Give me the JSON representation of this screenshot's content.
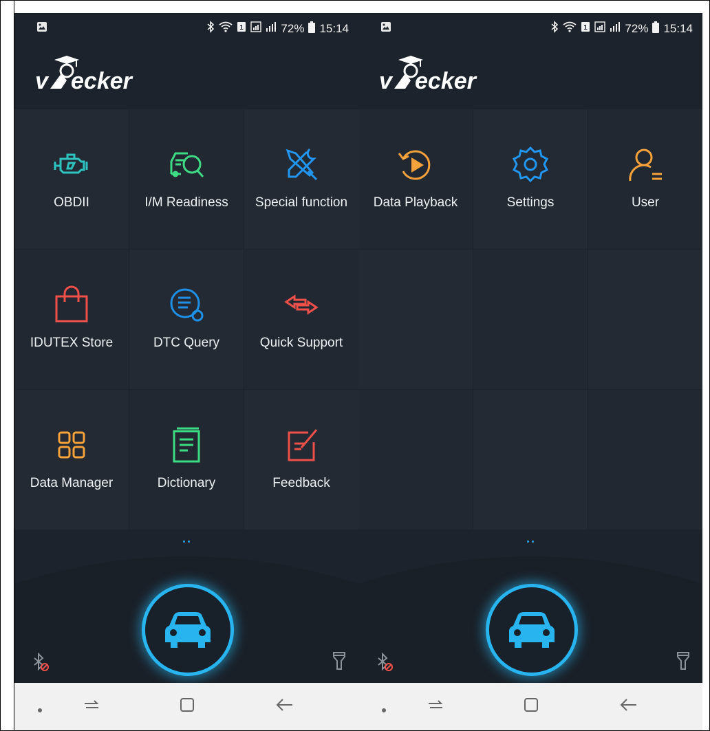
{
  "status_bar": {
    "battery": "72%",
    "time": "15:14",
    "icons": [
      "image-icon",
      "bluetooth-icon",
      "wifi-icon",
      "sim-icon",
      "signal-icon",
      "battery-icon"
    ]
  },
  "app": {
    "logo_text": "vecker"
  },
  "screens": [
    {
      "items": [
        {
          "label": "OBDII",
          "icon": "engine-icon",
          "color": "#2ec4c0"
        },
        {
          "label": "I/M Readiness",
          "icon": "car-inspect-icon",
          "color": "#3ddc84"
        },
        {
          "label": "Special function",
          "icon": "tools-icon",
          "color": "#2196f3"
        },
        {
          "label": "IDUTEX Store",
          "icon": "shopping-bag-icon",
          "color": "#f0504a"
        },
        {
          "label": "DTC Query",
          "icon": "document-search-icon",
          "color": "#1e90e8"
        },
        {
          "label": "Quick Support",
          "icon": "exchange-arrows-icon",
          "color": "#f0504a"
        },
        {
          "label": "Data Manager",
          "icon": "grid-apps-icon",
          "color": "#f7a23b"
        },
        {
          "label": "Dictionary",
          "icon": "book-icon",
          "color": "#3ddc84"
        },
        {
          "label": "Feedback",
          "icon": "edit-note-icon",
          "color": "#f0504a"
        }
      ]
    },
    {
      "items": [
        {
          "label": "Data Playback",
          "icon": "playback-icon",
          "color": "#f7a23b"
        },
        {
          "label": "Settings",
          "icon": "gear-icon",
          "color": "#2196f3"
        },
        {
          "label": "User",
          "icon": "user-icon",
          "color": "#f7a23b"
        }
      ]
    }
  ],
  "colors": {
    "accent": "#27b4ef",
    "background": "#1d232c",
    "navbar": "#f1f1f1"
  },
  "nav_bar": {
    "icons": [
      "dot-icon",
      "recent-apps-icon",
      "home-icon",
      "back-icon"
    ]
  }
}
